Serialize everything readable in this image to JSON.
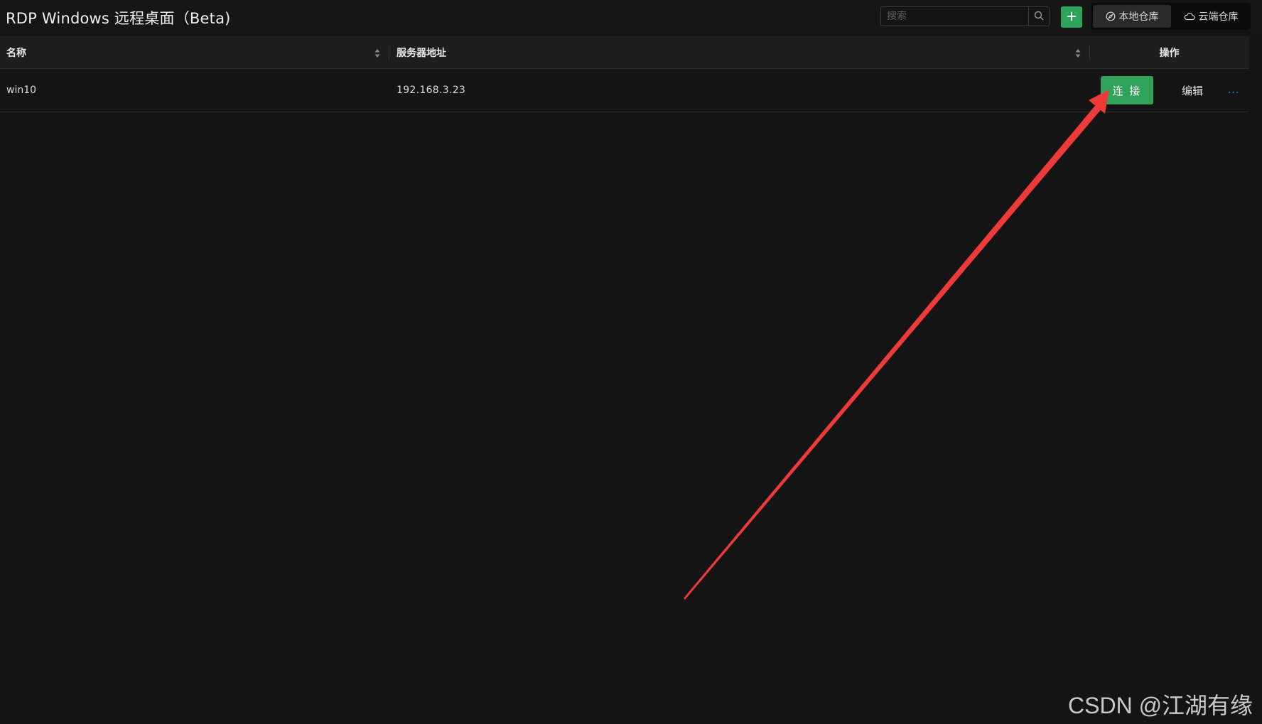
{
  "header": {
    "title": "RDP Windows 远程桌面（Beta)",
    "search": {
      "placeholder": "搜索",
      "value": ""
    },
    "repo_tabs": [
      {
        "label": "本地仓库",
        "icon": "compass-icon",
        "active": true
      },
      {
        "label": "云端仓库",
        "icon": "cloud-icon",
        "active": false
      }
    ]
  },
  "table": {
    "columns": [
      {
        "label": "名称",
        "sortable": true
      },
      {
        "label": "服务器地址",
        "sortable": true
      },
      {
        "label": "操作",
        "sortable": false
      }
    ],
    "rows": [
      {
        "name": "win10",
        "address": "192.168.3.23",
        "actions": {
          "connect": "连 接",
          "edit": "编辑",
          "more": "..."
        }
      }
    ]
  },
  "annotation": {
    "arrow_color": "#ef3a3a"
  },
  "watermark": "CSDN @江湖有缘",
  "colors": {
    "background": "#141414",
    "accent_green": "#2fa35a",
    "link_blue": "#3b82f6"
  }
}
